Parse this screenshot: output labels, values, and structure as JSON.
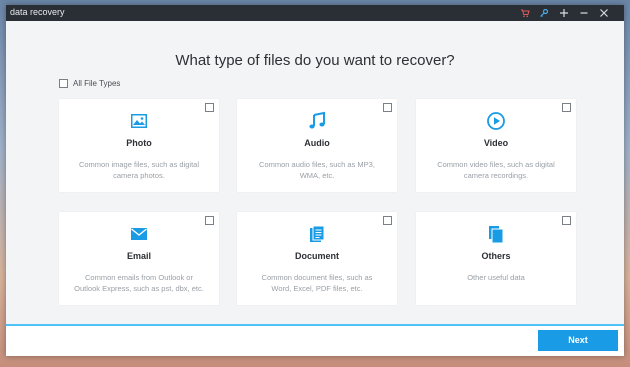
{
  "window": {
    "title": "data recovery"
  },
  "titlebar_icons": [
    "cart-icon",
    "key-icon",
    "plus-icon",
    "minimize-icon",
    "close-icon"
  ],
  "heading": "What type of files do you want to recover?",
  "all_types": {
    "label": "All File Types",
    "checked": false
  },
  "cards": [
    {
      "name": "Photo",
      "icon": "photo-icon",
      "desc": "Common image files, such as digital camera photos.",
      "checked": false
    },
    {
      "name": "Audio",
      "icon": "music-note-icon",
      "desc": "Common audio files, such as MP3, WMA, etc.",
      "checked": false
    },
    {
      "name": "Video",
      "icon": "play-icon",
      "desc": "Common video files, such as digital camera recordings.",
      "checked": false
    },
    {
      "name": "Email",
      "icon": "envelope-icon",
      "desc": "Common emails from Outlook or Outlook Express, such as pst, dbx, etc.",
      "checked": false
    },
    {
      "name": "Document",
      "icon": "document-icon",
      "desc": "Common document files, such as Word, Excel, PDF files, etc.",
      "checked": false
    },
    {
      "name": "Others",
      "icon": "files-icon",
      "desc": "Other useful data",
      "checked": false
    }
  ],
  "footer": {
    "next_label": "Next"
  },
  "colors": {
    "accent": "#1a9be6",
    "titlebar": "#2a2f35",
    "divider": "#4fc3f7",
    "cart_icon": "#e35b5b",
    "key_icon": "#4aa8e8"
  }
}
